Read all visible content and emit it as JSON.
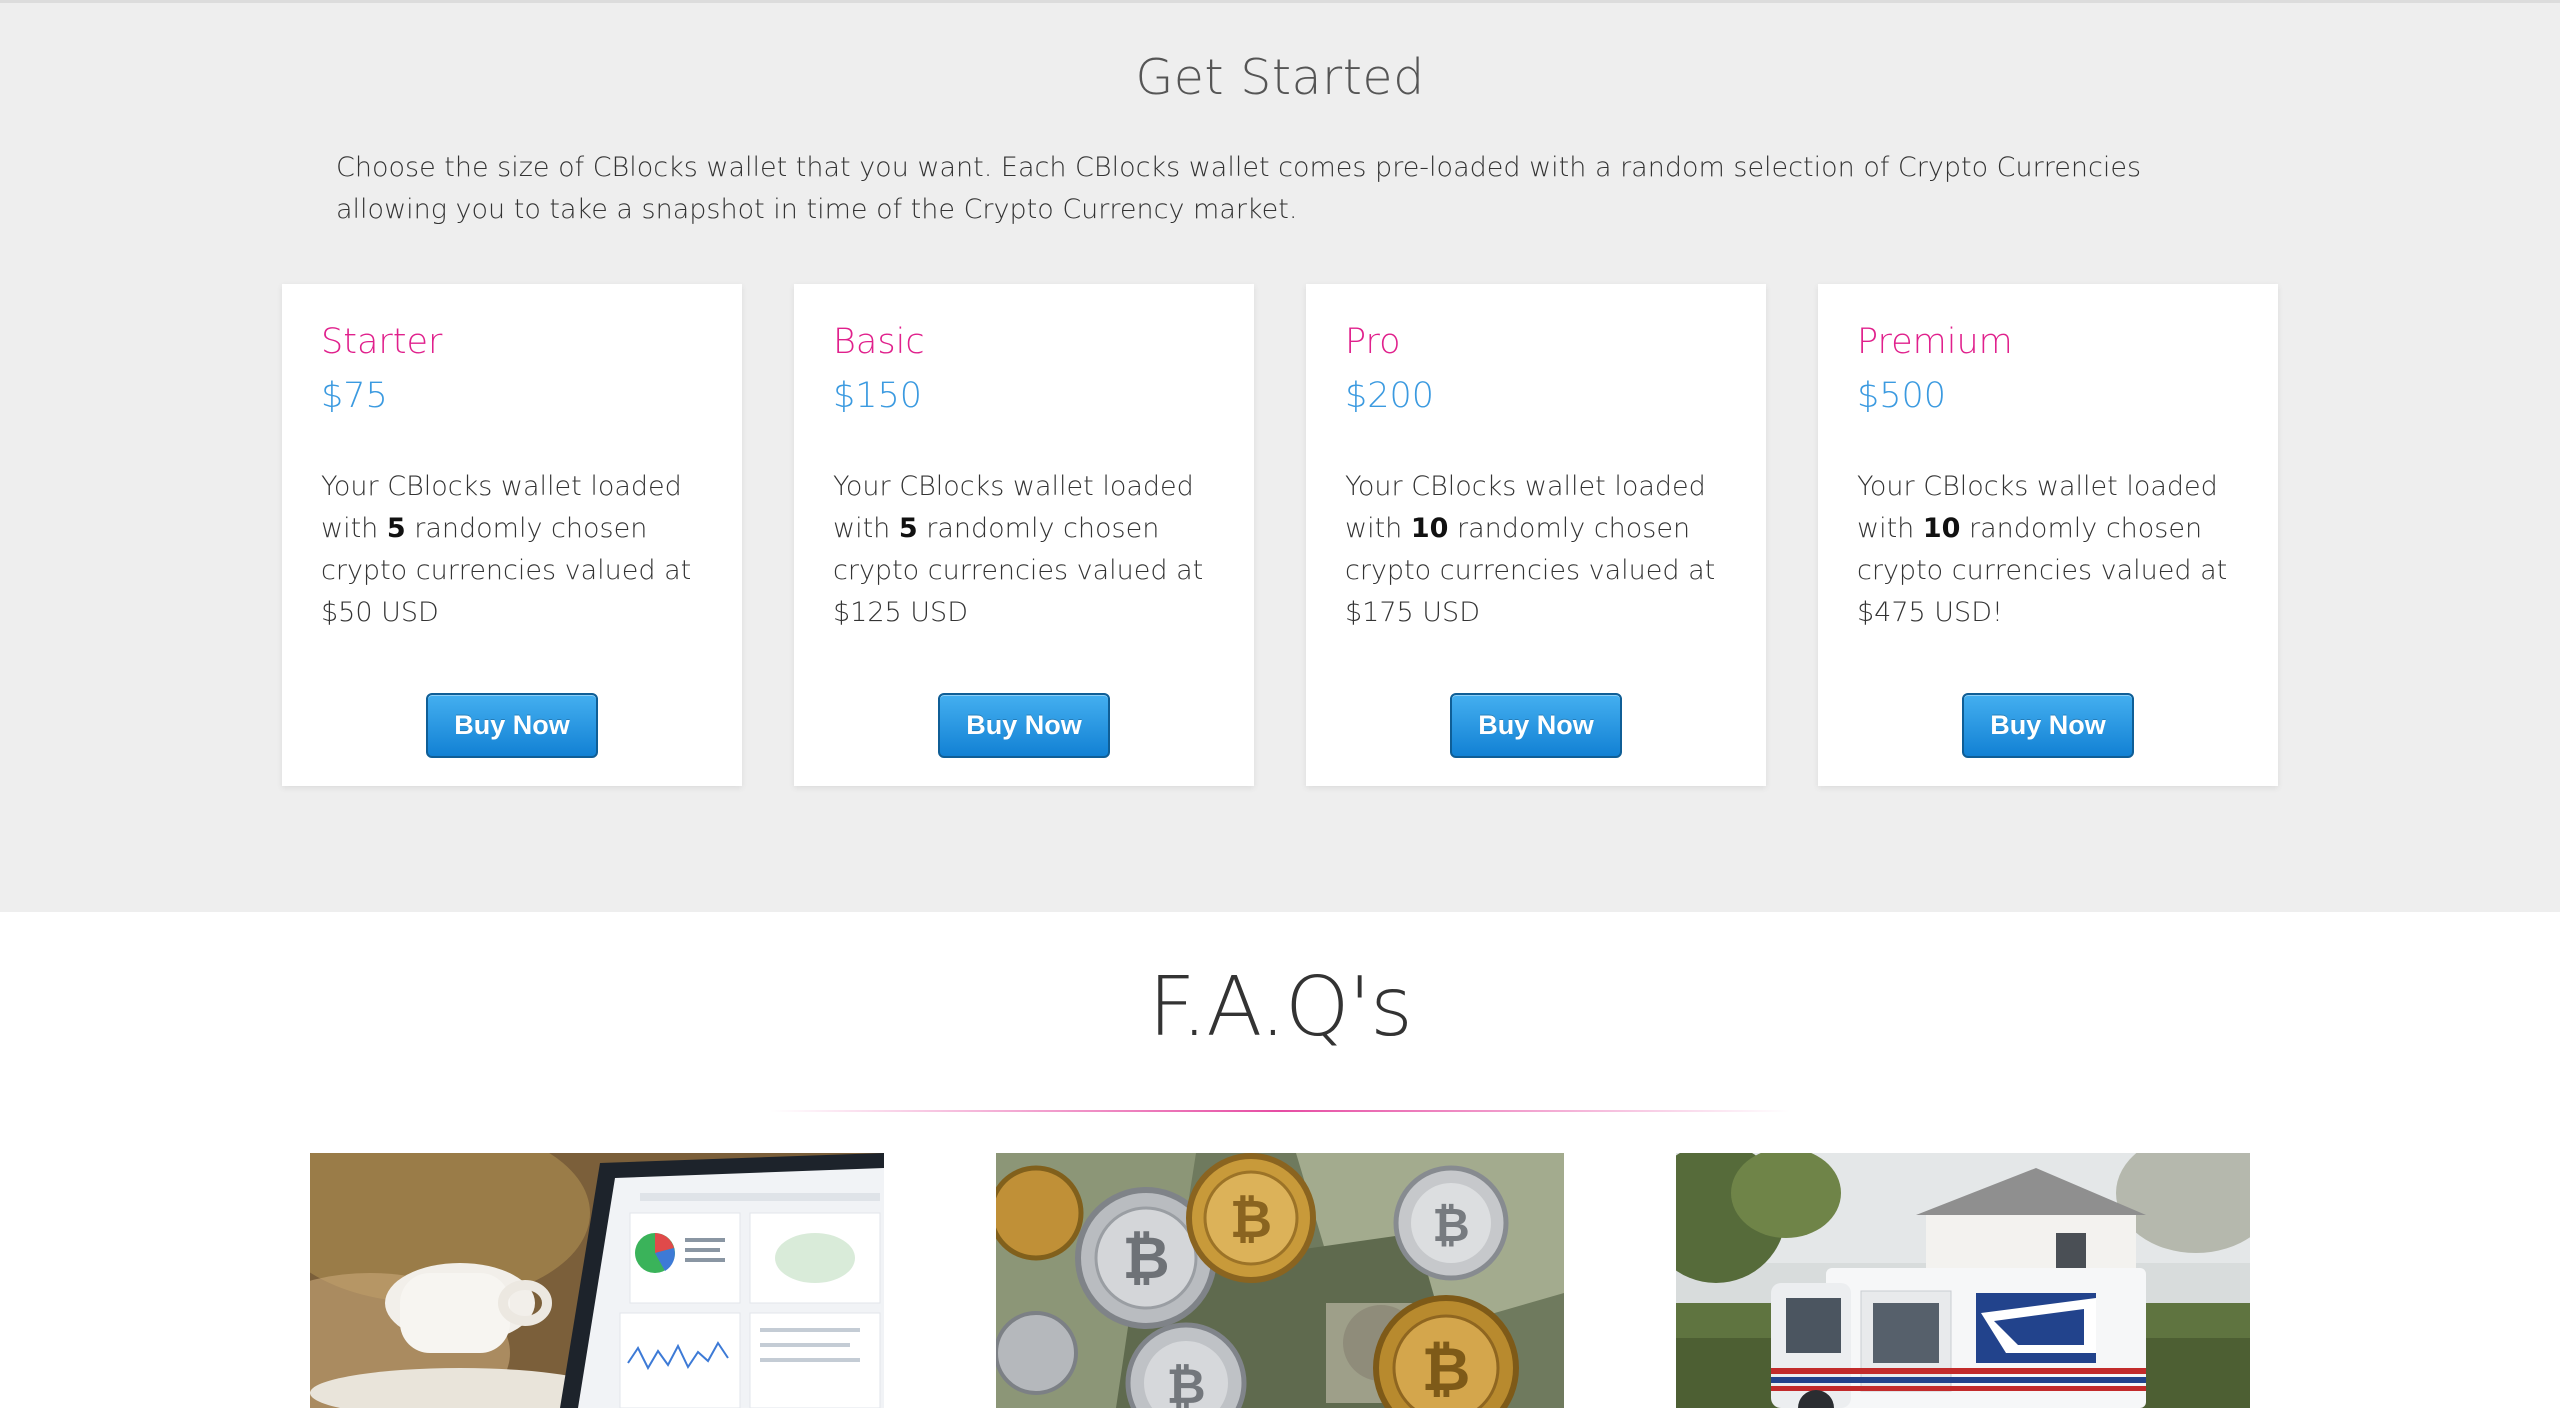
{
  "get_started": {
    "title": "Get Started",
    "intro": "Choose the size of CBlocks wallet that you want. Each CBlocks wallet comes pre-loaded with a random selection of Crypto Currencies allowing you to take a snapshot in time of the Crypto Currency market."
  },
  "plans": [
    {
      "name": "Starter",
      "price": "$75",
      "desc_pre": "Your CBlocks wallet loaded with ",
      "count": "5",
      "desc_post": " randomly chosen crypto currencies valued at $50 USD",
      "button": "Buy Now"
    },
    {
      "name": "Basic",
      "price": "$150",
      "desc_pre": "Your CBlocks wallet loaded with ",
      "count": "5",
      "desc_post": " randomly chosen crypto currencies valued at $125 USD",
      "button": "Buy Now"
    },
    {
      "name": "Pro",
      "price": "$200",
      "desc_pre": "Your CBlocks wallet loaded with ",
      "count": "10",
      "desc_post": " randomly chosen crypto currencies valued at $175 USD",
      "button": "Buy Now"
    },
    {
      "name": "Premium",
      "price": "$500",
      "desc_pre": "Your CBlocks wallet loaded with ",
      "count": "10",
      "desc_post": " randomly chosen crypto currencies valued at $475 USD!",
      "button": "Buy Now"
    }
  ],
  "faq": {
    "title": "F.A.Q's",
    "images": [
      "laptop-analytics-photo",
      "bitcoin-coins-cash-photo",
      "usps-mail-truck-photo"
    ]
  },
  "colors": {
    "accent_pink": "#e0208c",
    "price_blue": "#3b9ae0",
    "button_blue": "#1281d4",
    "section_gray": "#eeeeee"
  }
}
